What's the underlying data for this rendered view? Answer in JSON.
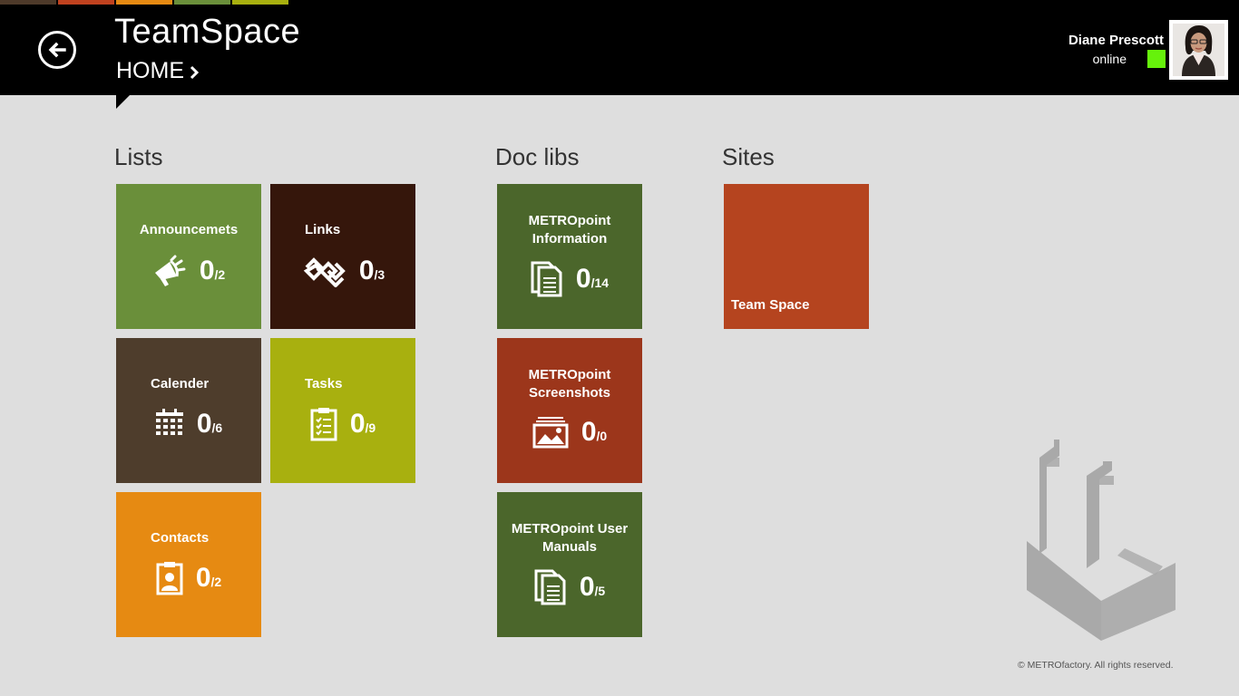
{
  "colors": {
    "accent_strip": [
      "#4e3a2a",
      "#c0421f",
      "#e68a12",
      "#6a8f3a",
      "#a8b00f"
    ],
    "online": "#66f20b"
  },
  "header": {
    "app_title": "TeamSpace",
    "breadcrumb": "HOME",
    "back_icon": "arrow-left-icon",
    "breadcrumb_icon": "chevron-right-icon"
  },
  "user": {
    "name": "Diane Prescott",
    "status": "online"
  },
  "sections": {
    "lists": "Lists",
    "doclibs": "Doc libs",
    "sites": "Sites"
  },
  "lists": [
    {
      "label": "Announcemets",
      "count": "0",
      "total": "/2",
      "icon": "megaphone-icon",
      "color": "#6a8f3a"
    },
    {
      "label": "Links",
      "count": "0",
      "total": "/3",
      "icon": "link-icon",
      "color": "#35160b"
    },
    {
      "label": "Calender",
      "count": "0",
      "total": "/6",
      "icon": "calendar-icon",
      "color": "#4e3d2c"
    },
    {
      "label": "Tasks",
      "count": "0",
      "total": "/9",
      "icon": "checklist-icon",
      "color": "#a8b00f"
    },
    {
      "label": "Contacts",
      "count": "0",
      "total": "/2",
      "icon": "contact-card-icon",
      "color": "#e68a12"
    }
  ],
  "doclibs": [
    {
      "label_line1": "METROpoint",
      "label_line2": "Information",
      "count": "0",
      "total": "/14",
      "icon": "documents-icon",
      "color": "#4b662b"
    },
    {
      "label_line1": "METROpoint",
      "label_line2": "Screenshots",
      "count": "0",
      "total": "/0",
      "icon": "pictures-icon",
      "color": "#9c361b"
    },
    {
      "label_line1": "METROpoint User",
      "label_line2": "Manuals",
      "count": "0",
      "total": "/5",
      "icon": "documents-icon",
      "color": "#4b662b"
    }
  ],
  "sites": [
    {
      "label": "Team Space",
      "color": "#b5441f"
    }
  ],
  "footer": {
    "copyright": "© METROfactory. All rights reserved."
  }
}
